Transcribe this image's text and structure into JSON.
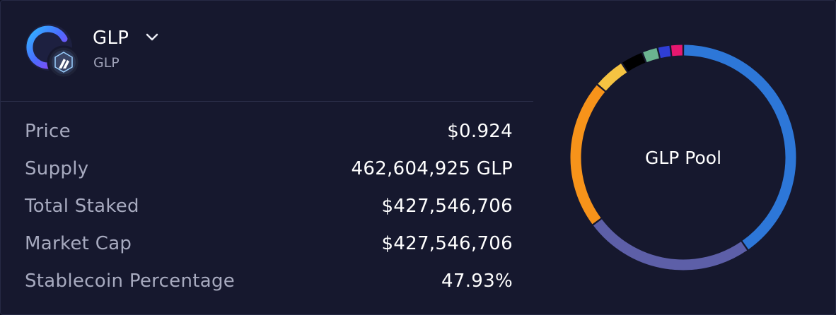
{
  "token": {
    "title": "GLP",
    "subtitle": "GLP",
    "logo_icon": "glp-logo-icon",
    "network_badge_icon": "arbitrum-network-icon",
    "dropdown_icon": "chevron-down-icon"
  },
  "stats": [
    {
      "label": "Price",
      "value": "$0.924"
    },
    {
      "label": "Supply",
      "value": "462,604,925 GLP"
    },
    {
      "label": "Total Staked",
      "value": "$427,546,706"
    },
    {
      "label": "Market Cap",
      "value": "$427,546,706"
    },
    {
      "label": "Stablecoin Percentage",
      "value": "47.93%"
    }
  ],
  "chart_data": {
    "type": "pie",
    "style": "donut",
    "center_label": "GLP Pool",
    "slices": [
      {
        "value": 39.5,
        "color": "#2d77d8"
      },
      {
        "value": 24.0,
        "color": "#5d5fa8"
      },
      {
        "value": 21.0,
        "color": "#f7931a"
      },
      {
        "value": 4.5,
        "color": "#f5c342"
      },
      {
        "value": 3.2,
        "color": "#000000"
      },
      {
        "value": 2.2,
        "color": "#6bb390"
      },
      {
        "value": 1.8,
        "color": "#2f3ed6"
      },
      {
        "value": 1.8,
        "color": "#e6176f"
      }
    ]
  },
  "colors": {
    "background": "#16182e",
    "border": "#262a45",
    "label_text": "#a7aabf",
    "value_text": "#ffffff"
  }
}
